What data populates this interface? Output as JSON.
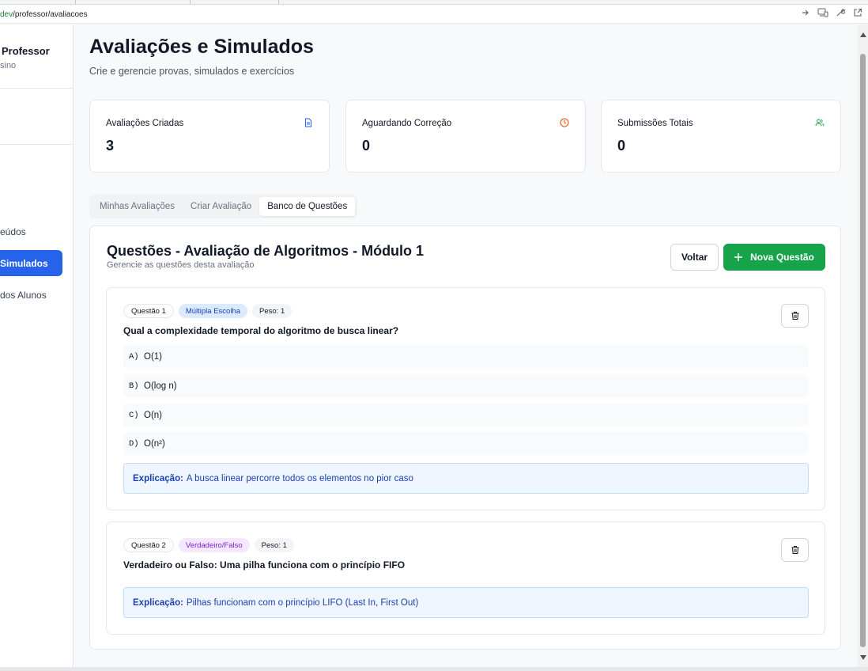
{
  "browser": {
    "url_host": "dev",
    "url_path": "/professor/avaliacoes",
    "actions": [
      "arrow-right-icon",
      "devices-icon",
      "wrench-icon",
      "open-external-icon"
    ]
  },
  "sidebar": {
    "user_name": "Professor",
    "user_sub": "sino",
    "items": [
      {
        "label": "eúdos",
        "active": false
      },
      {
        "label": "Simulados",
        "active": true
      },
      {
        "label": "dos Alunos",
        "active": false
      }
    ]
  },
  "page": {
    "title": "Avaliações e Simulados",
    "subtitle": "Crie e gerencie provas, simulados e exercícios"
  },
  "stats": [
    {
      "label": "Avaliações Criadas",
      "value": "3",
      "icon": "document-icon",
      "color": "#2563eb"
    },
    {
      "label": "Aguardando Correção",
      "value": "0",
      "icon": "clock-icon",
      "color": "#ea580c"
    },
    {
      "label": "Submissões Totais",
      "value": "0",
      "icon": "users-icon",
      "color": "#16a34a"
    }
  ],
  "tabs": [
    {
      "label": "Minhas Avaliações",
      "active": false
    },
    {
      "label": "Criar Avaliação",
      "active": false
    },
    {
      "label": "Banco de Questões",
      "active": true
    }
  ],
  "panel": {
    "title": "Questões - Avaliação de Algoritmos - Módulo 1",
    "subtitle": "Gerencie as questões desta avaliação",
    "back_label": "Voltar",
    "new_label": "Nova Questão"
  },
  "questions": [
    {
      "number": "Questão 1",
      "type": "Múltipla Escolha",
      "weight": "Peso: 1",
      "text": "Qual a complexidade temporal do algoritmo de busca linear?",
      "options": [
        {
          "letter": "A)",
          "text": "O(1)"
        },
        {
          "letter": "B)",
          "text": "O(log n)"
        },
        {
          "letter": "C)",
          "text": "O(n)"
        },
        {
          "letter": "D)",
          "text": "O(n²)"
        }
      ],
      "explanation_label": "Explicação:",
      "explanation": "A busca linear percorre todos os elementos no pior caso"
    },
    {
      "number": "Questão 2",
      "type": "Verdadeiro/Falso",
      "weight": "Peso: 1",
      "text": "Verdadeiro ou Falso: Uma pilha funciona com o princípio FIFO",
      "explanation_label": "Explicação:",
      "explanation": "Pilhas funcionam com o princípio LIFO (Last In, First Out)"
    }
  ]
}
